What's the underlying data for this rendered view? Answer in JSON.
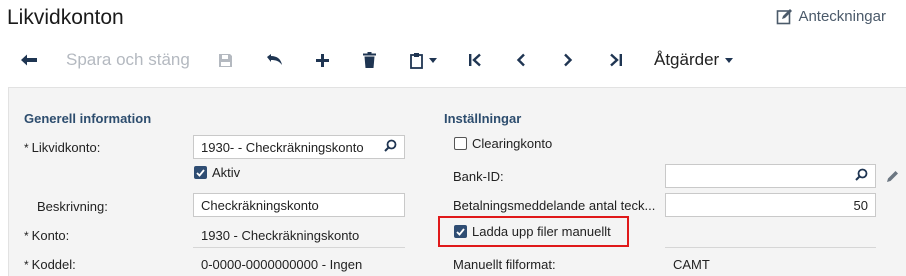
{
  "header": {
    "title": "Likvidkonton",
    "notes_label": "Anteckningar"
  },
  "toolbar": {
    "save_close_label": "Spara och stäng",
    "actions_label": "Åtgärder"
  },
  "general": {
    "section_title": "Generell information",
    "likvidkonto_label": "Likvidkonto:",
    "likvidkonto_value": "1930- - Checkräkningskonto",
    "aktiv_label": "Aktiv",
    "aktiv_checked": true,
    "beskrivning_label": "Beskrivning:",
    "beskrivning_value": "Checkräkningskonto",
    "konto_label": "Konto:",
    "konto_value": "1930 - Checkräkningskonto",
    "koddel_label": "Koddel:",
    "koddel_value": "0-0000-0000000000 - Ingen",
    "required_marker": "*"
  },
  "settings": {
    "section_title": "Inställningar",
    "clearingkonto_label": "Clearingkonto",
    "clearingkonto_checked": false,
    "bank_id_label": "Bank-ID:",
    "bank_id_value": "",
    "betalning_label": "Betalningsmeddelande antal teck...",
    "betalning_value": "50",
    "ladda_upp_label": "Ladda upp filer manuellt",
    "ladda_upp_checked": true,
    "filformat_label": "Manuellt filformat:",
    "filformat_value": "CAMT"
  },
  "colors": {
    "accent": "#2f4d73",
    "section_title": "#2d4d6e",
    "highlight": "#e0191a",
    "panel_bg": "#f4f4f4"
  }
}
